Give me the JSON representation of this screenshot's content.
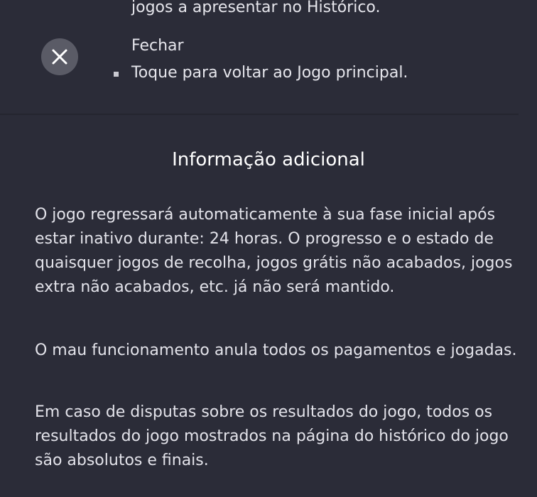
{
  "top": {
    "cut_line": "jogos a apresentar no Histórico.",
    "close": {
      "icon": "close-icon",
      "title": "Fechar",
      "bullet_text": "Toque para voltar ao Jogo principal."
    }
  },
  "additional_info": {
    "title": "Informação adicional",
    "paragraphs": [
      "O jogo regressará automaticamente à sua fase inicial após estar inativo durante: 24 horas. O progresso e o estado de quaisquer jogos de recolha, jogos grátis não acabados, jogos extra não acabados, etc. já não será mantido.",
      "O mau funcionamento anula todos os pagamentos e jogadas.",
      "Em caso de disputas sobre os resultados do jogo, todos os resultados do jogo mostrados na página do histórico do jogo são absolutos e finais."
    ]
  },
  "colors": {
    "background": "#2b2c38",
    "close_button": "#5a5b66",
    "text": "#e6e6ec"
  }
}
